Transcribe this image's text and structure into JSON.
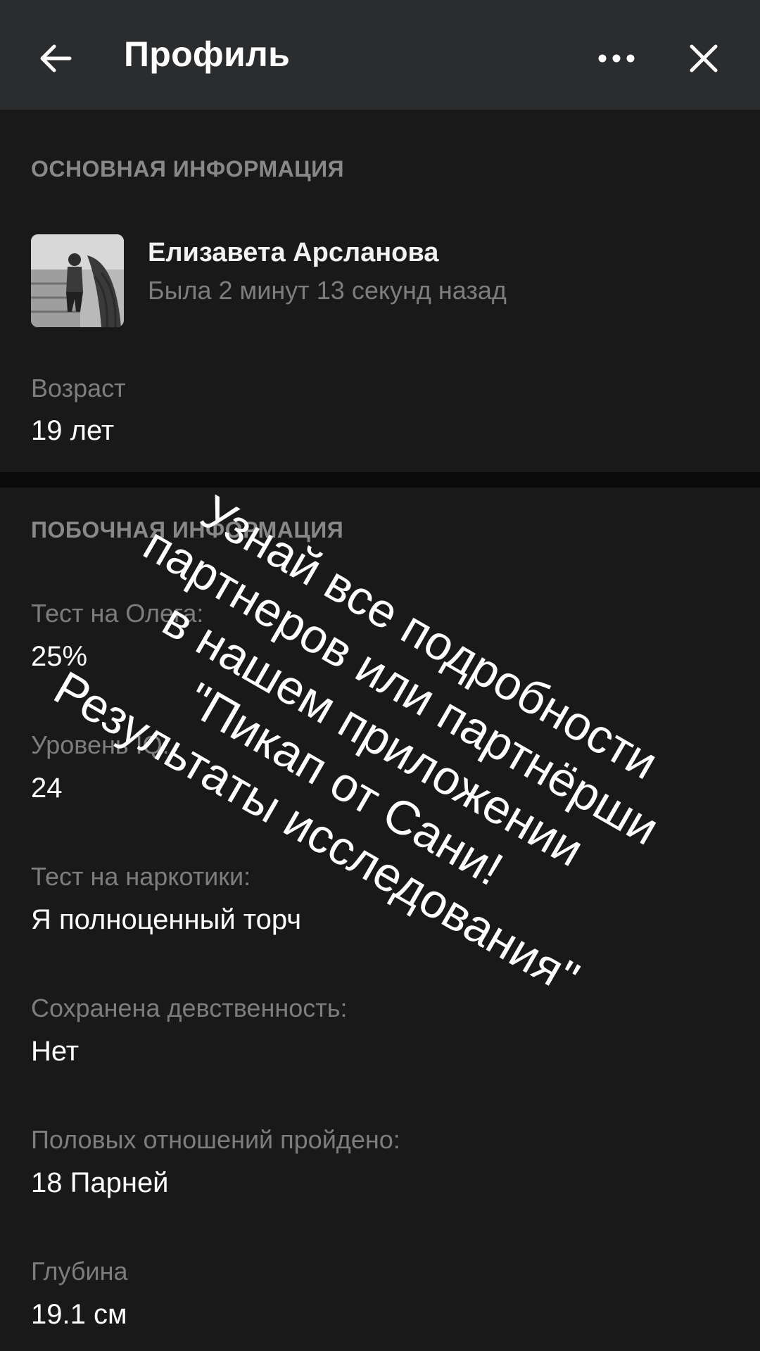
{
  "header": {
    "title": "Профиль"
  },
  "main_info": {
    "section_title": "ОСНОВНАЯ ИНФОРМАЦИЯ",
    "user": {
      "name": "Елизавета Арсланова",
      "status": "Была 2 минут 13 секунд назад"
    },
    "age_label": "Возраст",
    "age_value": "19 лет"
  },
  "side_info": {
    "section_title": "ПОБОЧНАЯ ИНФОРМАЦИЯ",
    "fields": [
      {
        "label": "Тест на Олега:",
        "value": "25%"
      },
      {
        "label": "Уровень IQ:",
        "value": "24"
      },
      {
        "label": "Тест на наркотики:",
        "value": "Я полноценный торч"
      },
      {
        "label": "Сохранена девственность:",
        "value": "Нет"
      },
      {
        "label": "Половых отношений пройдено:",
        "value": "18 Парней"
      },
      {
        "label": "Глубина",
        "value": "19.1 см"
      }
    ]
  },
  "overlay": {
    "lines": [
      "Узнай все подробности",
      "партнеров или партнёрши",
      "в нашем приложении",
      "\"Пикап от Сани!",
      "Результаты исследования\""
    ]
  },
  "colors": {
    "background": "#191919",
    "topbar": "#2b2c2e",
    "label": "#7d7d7d",
    "section_head": "#888888"
  }
}
